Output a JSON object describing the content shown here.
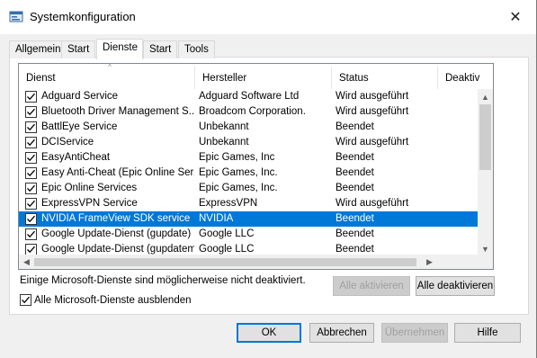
{
  "window": {
    "title": "Systemkonfiguration",
    "close_glyph": "✕"
  },
  "tabs": [
    "Allgemein",
    "Start",
    "Dienste",
    "Start",
    "Tools"
  ],
  "active_tab": "Dienste",
  "table": {
    "columns": [
      "Dienst",
      "Hersteller",
      "Status",
      "Deaktiv"
    ],
    "rows": [
      {
        "name": "Adguard Service",
        "vendor": "Adguard Software Ltd",
        "status": "Wird ausgeführt",
        "checked": true
      },
      {
        "name": "Bluetooth Driver Management S...",
        "vendor": "Broadcom Corporation.",
        "status": "Wird ausgeführt",
        "checked": true
      },
      {
        "name": "BattlEye Service",
        "vendor": "Unbekannt",
        "status": "Beendet",
        "checked": true
      },
      {
        "name": "DCIService",
        "vendor": "Unbekannt",
        "status": "Wird ausgeführt",
        "checked": true
      },
      {
        "name": "EasyAntiCheat",
        "vendor": "Epic Games, Inc",
        "status": "Beendet",
        "checked": true
      },
      {
        "name": "Easy Anti-Cheat (Epic Online Ser...",
        "vendor": "Epic Games, Inc.",
        "status": "Beendet",
        "checked": true
      },
      {
        "name": "Epic Online Services",
        "vendor": "Epic Games, Inc.",
        "status": "Beendet",
        "checked": true
      },
      {
        "name": "ExpressVPN Service",
        "vendor": "ExpressVPN",
        "status": "Wird ausgeführt",
        "checked": true
      },
      {
        "name": "NVIDIA FrameView SDK service",
        "vendor": "NVIDIA",
        "status": "Beendet",
        "checked": true,
        "selected": true
      },
      {
        "name": "Google Update-Dienst (gupdate)",
        "vendor": "Google LLC",
        "status": "Beendet",
        "checked": true
      },
      {
        "name": "Google Update-Dienst (gupdatem)",
        "vendor": "Google LLC",
        "status": "Beendet",
        "checked": true
      }
    ]
  },
  "notice": "Einige Microsoft-Dienste sind möglicherweise nicht deaktiviert.",
  "buttons": {
    "enable_all": "Alle aktivieren",
    "disable_all": "Alle deaktivieren",
    "ok": "OK",
    "cancel": "Abbrechen",
    "apply": "Übernehmen",
    "help": "Hilfe"
  },
  "hide_ms": {
    "label": "Alle Microsoft-Dienste ausblenden",
    "checked": true
  },
  "colors": {
    "selection": "#0078d7",
    "dialog_bg": "#f0f0f0"
  }
}
